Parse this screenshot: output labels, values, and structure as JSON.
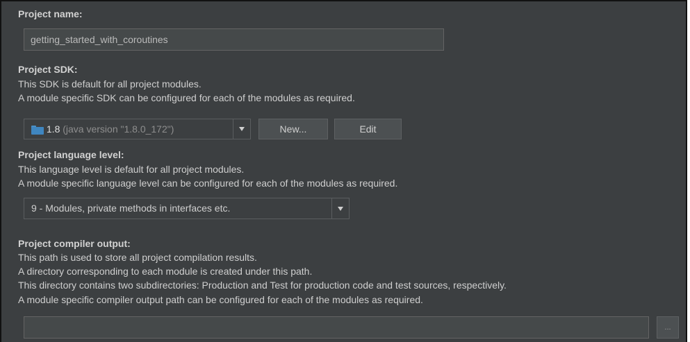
{
  "project_name": {
    "label": "Project name:",
    "value": "getting_started_with_coroutines"
  },
  "project_sdk": {
    "label": "Project SDK:",
    "desc_line1": "This SDK is default for all project modules.",
    "desc_line2": "A module specific SDK can be configured for each of the modules as required.",
    "selected_version": "1.8",
    "selected_detail": "(java version \"1.8.0_172\")",
    "new_button": "New...",
    "edit_button": "Edit"
  },
  "language_level": {
    "label": "Project language level:",
    "desc_line1": "This language level is default for all project modules.",
    "desc_line2": "A module specific language level can be configured for each of the modules as required.",
    "selected": "9 - Modules, private methods in interfaces etc."
  },
  "compiler_output": {
    "label": "Project compiler output:",
    "desc_line1": "This path is used to store all project compilation results.",
    "desc_line2": "A directory corresponding to each module is created under this path.",
    "desc_line3": "This directory contains two subdirectories: Production and Test for production code and test sources, respectively.",
    "desc_line4": "A module specific compiler output path can be configured for each of the modules as required.",
    "path_value": "",
    "browse_button": "..."
  },
  "colors": {
    "background": "#3c3f41",
    "input_bg": "#45494a",
    "text": "#cfcfcf",
    "sdk_icon": "#3f86c0"
  }
}
